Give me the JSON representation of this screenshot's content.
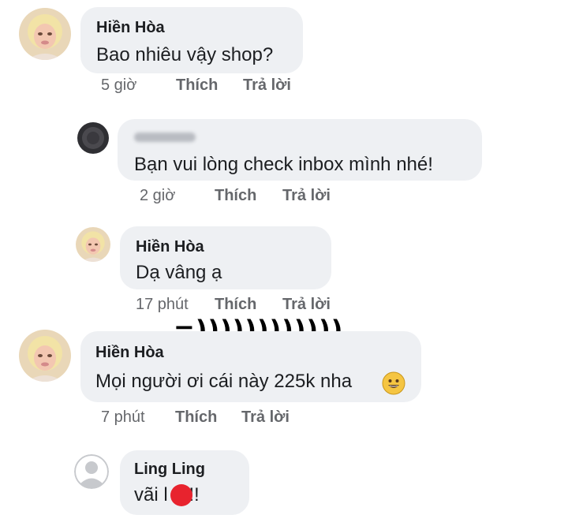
{
  "comments": [
    {
      "author": "Hiền Hòa",
      "text": "Bao nhiêu vậy shop?",
      "time": "5 giờ",
      "like": "Thích",
      "reply": "Trả lời"
    },
    {
      "author": "",
      "text": "Bạn vui lòng check inbox mình nhé!",
      "time": "2 giờ",
      "like": "Thích",
      "reply": "Trả lời"
    },
    {
      "author": "Hiền Hòa",
      "text": "Dạ vâng ạ",
      "time": "17 phút",
      "like": "Thích",
      "reply": "Trả lời"
    },
    {
      "author": "Hiền Hòa",
      "text": "Mọi người ơi cái này 225k nha",
      "time": "7 phút",
      "like": "Thích",
      "reply": "Trả lời",
      "emoji": "grinning-face-emoji"
    },
    {
      "author": "Ling Ling",
      "text": "vãi l    !!",
      "time": "",
      "like": "",
      "reply": ""
    }
  ],
  "overlay": {
    "text": "=))))))))))))"
  },
  "colors": {
    "bubble": "#eef0f3",
    "meta": "#65676b",
    "censor_dot": "#e8232e"
  }
}
